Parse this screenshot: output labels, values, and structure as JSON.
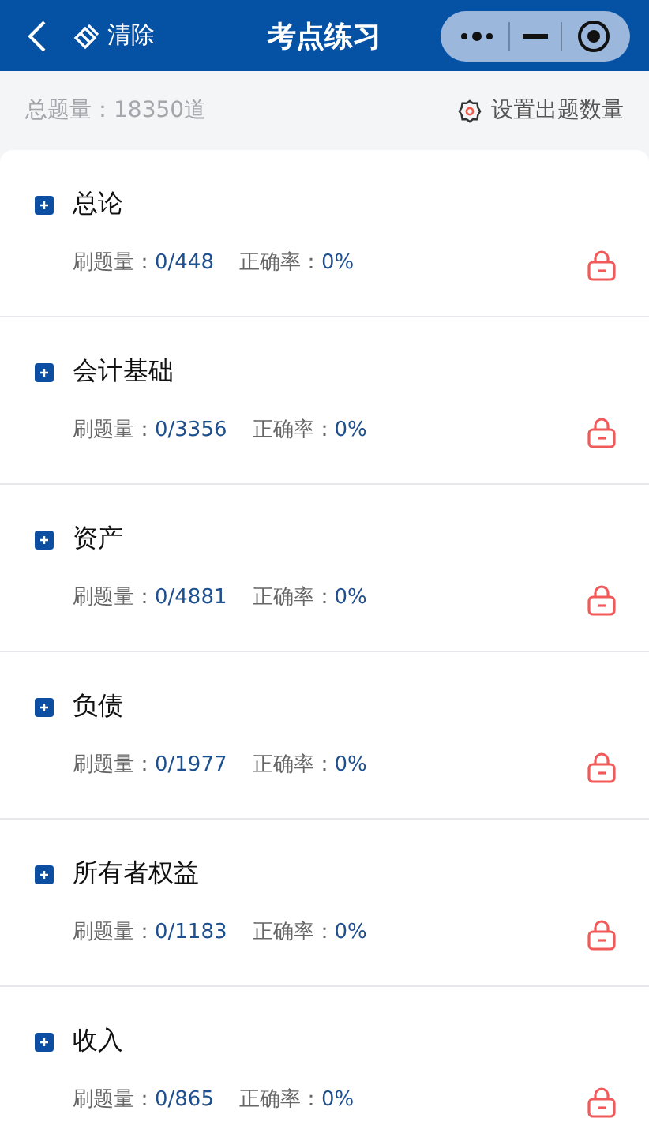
{
  "header": {
    "clear_label": "清除",
    "title": "考点练习"
  },
  "summary": {
    "total": "总题量：18350道",
    "settings": "设置出题数量"
  },
  "topics": [
    {
      "title": "总论",
      "count_label": "刷题量：",
      "count": "0/448",
      "accuracy_label": "正确率：",
      "accuracy": "0%",
      "locked": true
    },
    {
      "title": "会计基础",
      "count_label": "刷题量：",
      "count": "0/3356",
      "accuracy_label": "正确率：",
      "accuracy": "0%",
      "locked": true
    },
    {
      "title": "资产",
      "count_label": "刷题量：",
      "count": "0/4881",
      "accuracy_label": "正确率：",
      "accuracy": "0%",
      "locked": true
    },
    {
      "title": "负债",
      "count_label": "刷题量：",
      "count": "0/1977",
      "accuracy_label": "正确率：",
      "accuracy": "0%",
      "locked": true
    },
    {
      "title": "所有者权益",
      "count_label": "刷题量：",
      "count": "0/1183",
      "accuracy_label": "正确率：",
      "accuracy": "0%",
      "locked": true
    },
    {
      "title": "收入",
      "count_label": "刷题量：",
      "count": "0/865",
      "accuracy_label": "正确率：",
      "accuracy": "0%",
      "locked": true
    }
  ]
}
